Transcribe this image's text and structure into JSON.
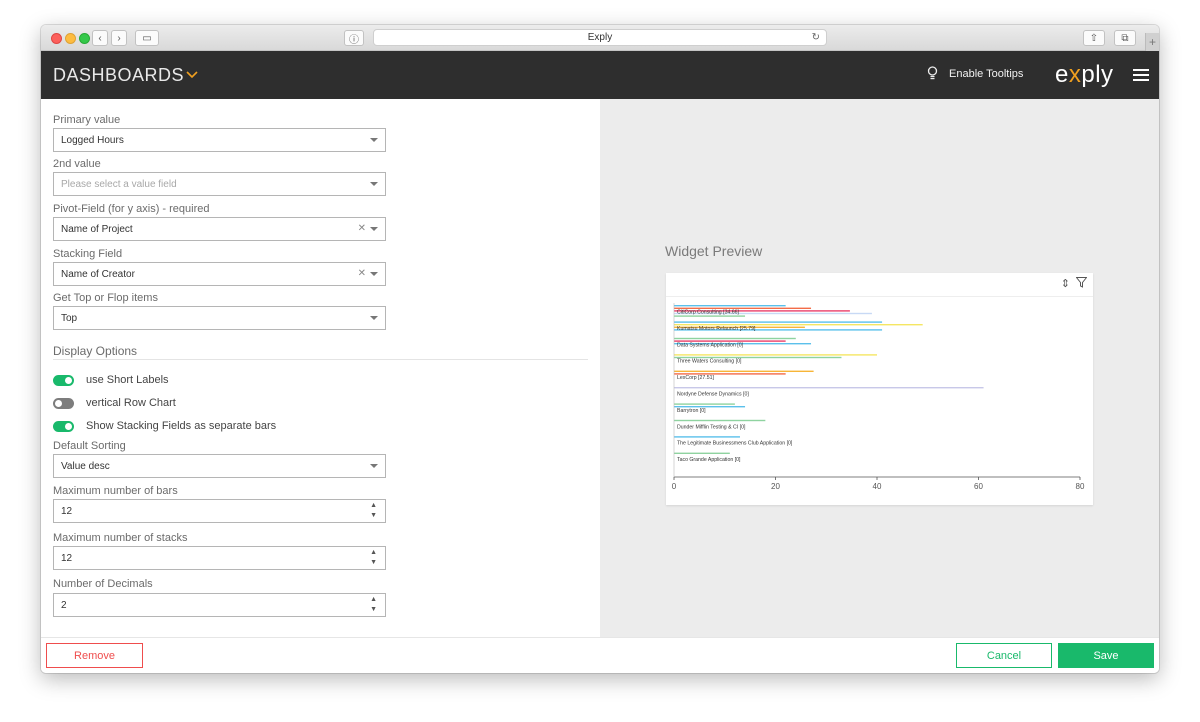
{
  "browser": {
    "tab_title": "Exply"
  },
  "header": {
    "title": "DASHBOARDS",
    "tooltips_label": "Enable Tooltips",
    "logo_pre": "e",
    "logo_x": "x",
    "logo_post": "ply"
  },
  "form": {
    "primary_value": {
      "label": "Primary value",
      "value": "Logged Hours"
    },
    "second_value": {
      "label": "2nd value",
      "placeholder": "Please select a value field"
    },
    "pivot_field": {
      "label": "Pivot-Field (for y axis) - required",
      "value": "Name of Project"
    },
    "stacking_field": {
      "label": "Stacking Field",
      "value": "Name of Creator"
    },
    "top_flop": {
      "label": "Get Top or Flop items",
      "value": "Top"
    },
    "display_options": "Display Options",
    "toggles": [
      {
        "label": "use Short Labels",
        "on": true
      },
      {
        "label": "vertical Row Chart",
        "on": false
      },
      {
        "label": "Show Stacking Fields as separate bars",
        "on": true
      }
    ],
    "default_sorting": {
      "label": "Default Sorting",
      "value": "Value desc"
    },
    "max_bars": {
      "label": "Maximum number of bars",
      "value": "12"
    },
    "max_stacks": {
      "label": "Maximum number of stacks",
      "value": "12"
    },
    "decimals": {
      "label": "Number of Decimals",
      "value": "2"
    }
  },
  "preview": {
    "title": "Widget Preview"
  },
  "chart_data": {
    "type": "bar",
    "orientation": "horizontal",
    "xlim": [
      0,
      80
    ],
    "x_ticks": [
      "0",
      "20",
      "40",
      "60",
      "80"
    ],
    "categories": [
      "CitiCorp Consulting [34.66]",
      "Kumatsu Motors Relaunch [25.79]",
      "Data Systems Application [0]",
      "Three Waters Consulting [0]",
      "LexCorp [27.51]",
      "Nordyne Defense Dynamics [0]",
      "Barrytron [0]",
      "Dunder Mifflin Testing & CI [0]",
      "The Legitimate Businessmens Club Application [0]",
      "Taco Grande Application [0]"
    ],
    "groups": [
      [
        {
          "value": 22,
          "color": "#5bc0eb"
        },
        {
          "value": 27,
          "color": "#f36c48"
        },
        {
          "value": 34.66,
          "color": "#e9406a"
        },
        {
          "value": 39,
          "color": "#c8d9f5"
        },
        {
          "value": 14,
          "color": "#8fd3a0"
        }
      ],
      [
        {
          "value": 41,
          "color": "#5bc0eb"
        },
        {
          "value": 49,
          "color": "#f5e663"
        },
        {
          "value": 25.79,
          "color": "#f7b538"
        },
        {
          "value": 41,
          "color": "#5bc0eb"
        }
      ],
      [
        {
          "value": 24,
          "color": "#8fd3a0"
        },
        {
          "value": 22,
          "color": "#e9406a"
        },
        {
          "value": 27,
          "color": "#5bc0eb"
        }
      ],
      [
        {
          "value": 40,
          "color": "#f5e663"
        },
        {
          "value": 33,
          "color": "#8fd3a0"
        }
      ],
      [
        {
          "value": 27.51,
          "color": "#f7b538"
        },
        {
          "value": 22,
          "color": "#f36c48"
        }
      ],
      [
        {
          "value": 61,
          "color": "#c8c8e8"
        }
      ],
      [
        {
          "value": 12,
          "color": "#8fd3a0"
        },
        {
          "value": 14,
          "color": "#5bc0eb"
        }
      ],
      [
        {
          "value": 18,
          "color": "#8fd3a0"
        }
      ],
      [
        {
          "value": 13,
          "color": "#5bc0eb"
        }
      ],
      [
        {
          "value": 11,
          "color": "#8fd3a0"
        }
      ]
    ]
  },
  "footer": {
    "remove": "Remove",
    "cancel": "Cancel",
    "save": "Save"
  }
}
